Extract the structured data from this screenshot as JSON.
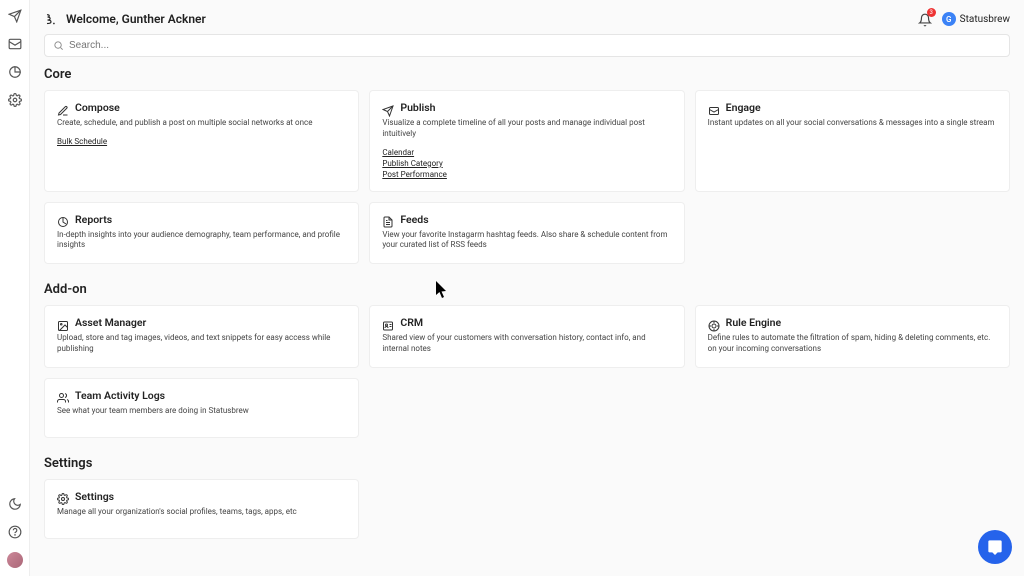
{
  "header": {
    "welcome": "Welcome, Gunther Ackner",
    "notification_count": "3",
    "org_initial": "G",
    "org_name": "Statusbrew"
  },
  "search": {
    "placeholder": "Search..."
  },
  "sections": {
    "core": {
      "title": "Core",
      "compose": {
        "title": "Compose",
        "desc": "Create, schedule, and publish a post on multiple social networks at once",
        "link_bulk": "Bulk Schedule"
      },
      "publish": {
        "title": "Publish",
        "desc": "Visualize a complete timeline of all your posts and manage individual post intuitively",
        "link_cal": "Calendar",
        "link_cat": "Publish Category",
        "link_perf": "Post Performance"
      },
      "engage": {
        "title": "Engage",
        "desc": "Instant updates on all your social conversations & messages into a single stream"
      },
      "reports": {
        "title": "Reports",
        "desc": "In-depth insights into your audience demography, team performance, and profile insights"
      },
      "feeds": {
        "title": "Feeds",
        "desc": "View your favorite Instagarm hashtag feeds. Also share & schedule content from your curated list of RSS feeds"
      }
    },
    "addon": {
      "title": "Add-on",
      "asset": {
        "title": "Asset Manager",
        "desc": "Upload, store and tag images, videos, and text snippets for easy access while publishing"
      },
      "crm": {
        "title": "CRM",
        "desc": "Shared view of your customers with conversation history, contact info, and internal notes"
      },
      "rule": {
        "title": "Rule Engine",
        "desc": "Define rules to automate the filtration of spam, hiding & deleting comments, etc. on your incoming conversations"
      },
      "activity": {
        "title": "Team Activity Logs",
        "desc": "See what your team members are doing in Statusbrew"
      }
    },
    "settings": {
      "title": "Settings",
      "card": {
        "title": "Settings",
        "desc": "Manage all your organization's social profiles, teams, tags, apps, etc"
      }
    }
  }
}
